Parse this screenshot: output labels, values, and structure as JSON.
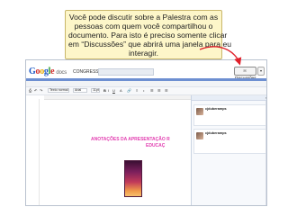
{
  "callout": {
    "lines": [
      "Você pode discutir sobre a Palestra com as",
      "pessoas com quem você compartilhou o",
      "documento. Para isto é preciso somente clicar",
      "em “Discussões” que abrirá uma janela para eu",
      "interagir."
    ]
  },
  "app": {
    "logo_google": [
      "G",
      "o",
      "o",
      "g",
      "l",
      "e"
    ],
    "logo_docs": "docs",
    "breadcrumb": "CONGRESSO",
    "discussions_button": "Discussões",
    "share_button": "▾"
  },
  "menu": [
    "Arquivo",
    "Editar",
    "Visualizar",
    "Inserir",
    "Formatar",
    "Ferramentas",
    "Tabela",
    "Ajuda"
  ],
  "toolbar": {
    "style_select": "Texto normal",
    "font_select": "Arial",
    "size_select": "11pt",
    "bold": "B",
    "italic": "I",
    "underline": "U"
  },
  "document": {
    "title_line1": "ANOTAÇÕES DA APRESENTAÇÃO R",
    "title_line2": "EDUCAÇ"
  },
  "discussion_panel": {
    "posts": [
      {
        "author": "cjduberamps",
        "date": "",
        "text": "",
        "note": ""
      },
      {
        "author": "cjduberamps",
        "date": "",
        "text": "",
        "note": ""
      }
    ]
  },
  "colors": {
    "callout_bg": "#fdf6c9",
    "title_pink": "#e23db0",
    "arrow_red": "#e0202a",
    "accent_blue": "#6d8fd1"
  }
}
